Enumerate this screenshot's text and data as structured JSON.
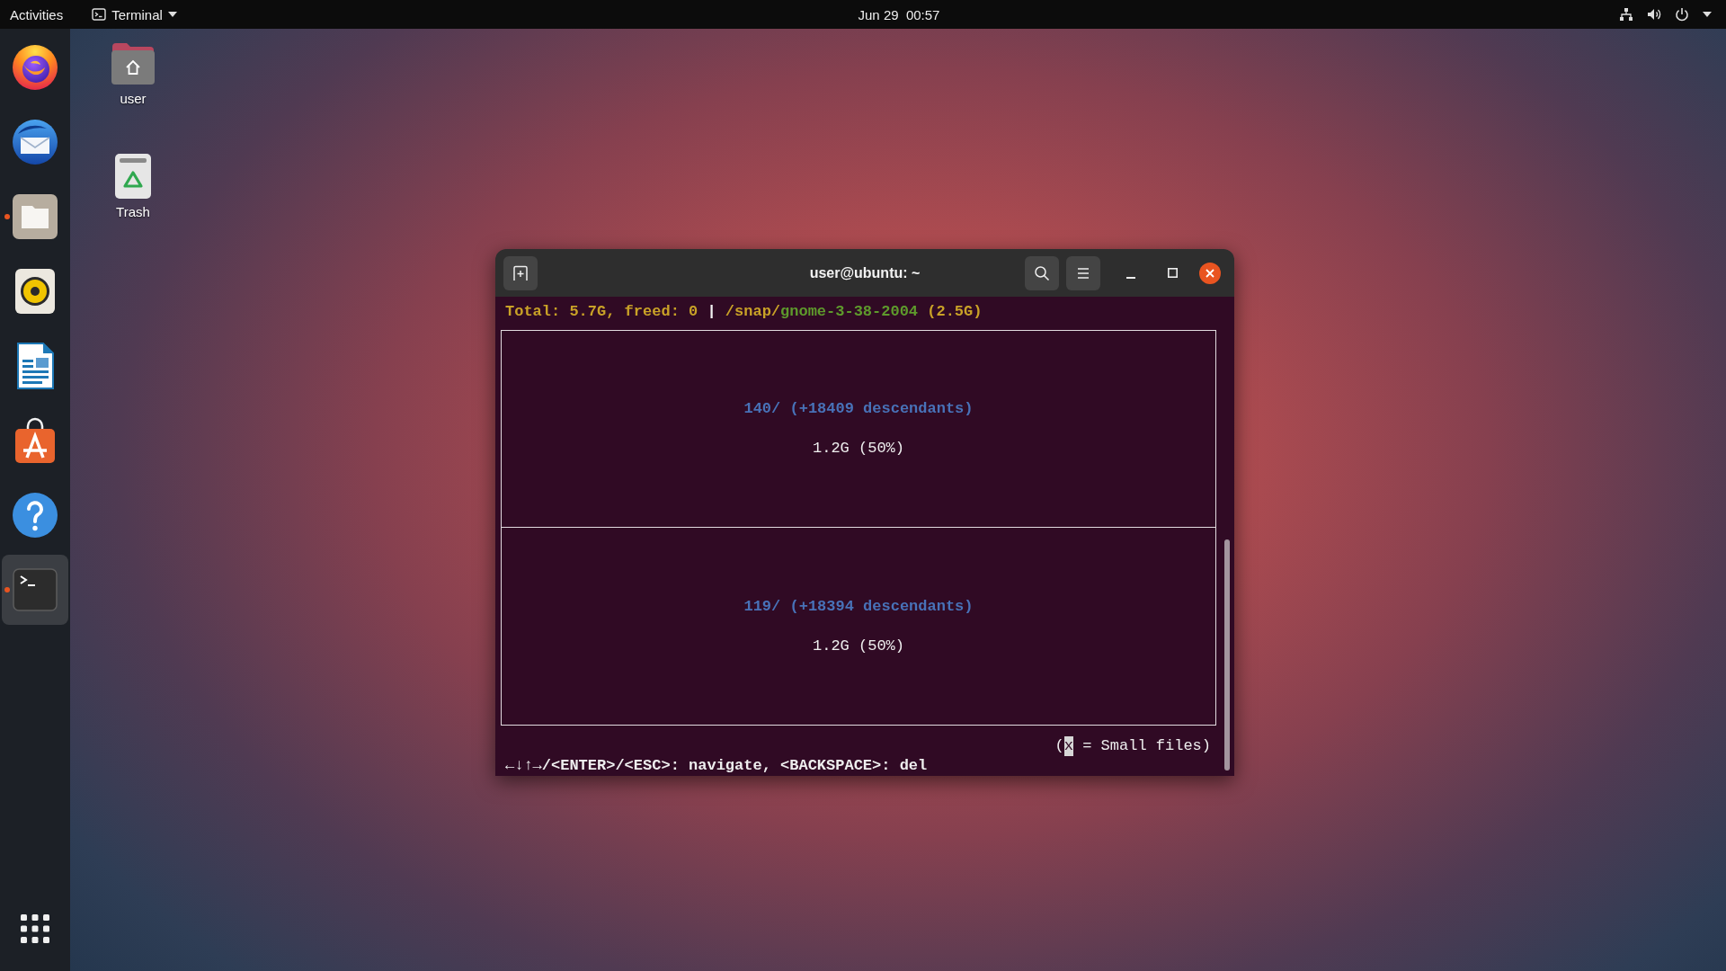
{
  "top_bar": {
    "activities": "Activities",
    "app_menu": "Terminal",
    "clock": "Jun 29  00:57"
  },
  "dock": {
    "apps": [
      {
        "kind": "browser",
        "running": false,
        "selected": false
      },
      {
        "kind": "mail",
        "running": false,
        "selected": false
      },
      {
        "kind": "files",
        "running": true,
        "selected": false
      },
      {
        "kind": "music",
        "running": false,
        "selected": false
      },
      {
        "kind": "writer",
        "running": false,
        "selected": false
      },
      {
        "kind": "store",
        "running": false,
        "selected": false
      },
      {
        "kind": "help",
        "running": false,
        "selected": false
      },
      {
        "kind": "terminal",
        "running": true,
        "selected": true
      }
    ]
  },
  "desktop_icons": [
    {
      "kind": "home",
      "label": "user"
    },
    {
      "kind": "trash",
      "label": "Trash"
    }
  ],
  "terminal": {
    "title": "user@ubuntu: ~",
    "status_line": {
      "summary": "Total: 5.7G, freed: 0",
      "separator": "|",
      "parent_path": "/snap/",
      "folder": "gnome-3-38-2004",
      "folder_size": "(2.5G)"
    },
    "tiles": [
      {
        "name": "140/ (+18409 descendants)",
        "size": "1.2G (50%)"
      },
      {
        "name": "119/ (+18394 descendants)",
        "size": "1.2G (50%)"
      }
    ],
    "legend": {
      "prefix": "(",
      "key": "x",
      "suffix": "= Small files)",
      "cursor": true
    },
    "help_line": "←↓↑→/<ENTER>/<ESC>: navigate, <BACKSPACE>: del"
  }
}
